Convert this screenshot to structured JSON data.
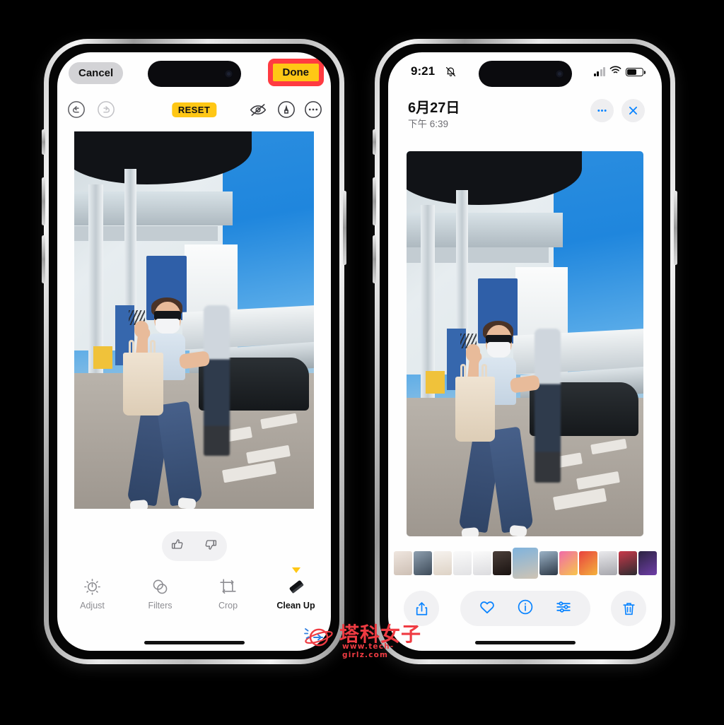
{
  "left_phone": {
    "name": "photos-edit-screen",
    "toolbar": {
      "cancel_label": "Cancel",
      "done_label": "Done",
      "done_highlight_fill": "#ffc715",
      "done_highlight_border": "#ff3b41"
    },
    "edit_tools": {
      "undo_icon": "undo-icon",
      "redo_icon": "redo-icon",
      "reset_label": "RESET",
      "reset_badge_color": "#ffc715",
      "hide_icon": "eye-slash-icon",
      "markup_icon": "markup-pen-icon",
      "more_icon": "ellipsis-icon"
    },
    "feedback": {
      "thumbs_up_icon": "thumbs-up-icon",
      "thumbs_down_icon": "thumbs-down-icon"
    },
    "bottom_tools": [
      {
        "label": "Adjust",
        "icon": "adjust-icon",
        "active": false
      },
      {
        "label": "Filters",
        "icon": "filters-icon",
        "active": false
      },
      {
        "label": "Crop",
        "icon": "crop-icon",
        "active": false
      },
      {
        "label": "Clean Up",
        "icon": "eraser-icon",
        "active": true
      }
    ]
  },
  "right_phone": {
    "name": "photos-viewer-screen",
    "status_bar": {
      "time": "9:21",
      "mute_icon": "bell-slash-icon",
      "cellular_icon": "signal-bars-icon",
      "wifi_icon": "wifi-icon",
      "battery_icon": "battery-icon"
    },
    "header": {
      "date": "6月27日",
      "time": "下午 6:39",
      "more_icon": "ellipsis-icon",
      "close_icon": "close-icon",
      "accent_color": "#0a84ff"
    },
    "filmstrip": {
      "thumb_count": 13,
      "current_index": 6
    },
    "bottom_toolbar": {
      "share_icon": "share-icon",
      "favorite_icon": "heart-icon",
      "info_icon": "info-icon",
      "adjust_icon": "sliders-icon",
      "trash_icon": "trash-icon"
    }
  },
  "watermark": {
    "brand": "塔科女子",
    "url": "www.tech-girlz.com",
    "color": "#ef3b42",
    "logo_icon": "planet-rocket-icon"
  }
}
